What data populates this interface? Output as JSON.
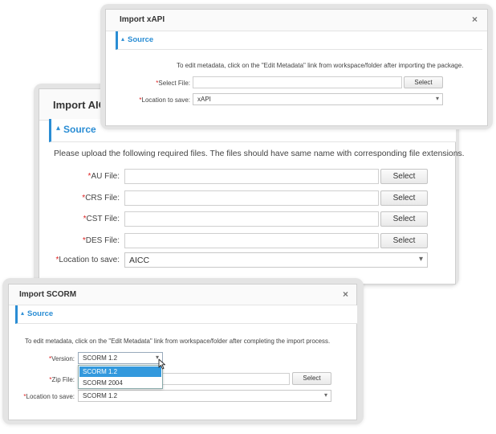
{
  "xapi": {
    "title": "Import xAPI",
    "close": "×",
    "section": "Source",
    "caret": "▴",
    "note": "To edit metadata, click on the \"Edit Metadata\" link from workspace/folder after importing the package.",
    "required": "*",
    "fields": [
      {
        "label": "Select File:",
        "button": "Select",
        "value": ""
      }
    ],
    "location_label": "Location to save:",
    "location_value": "xAPI"
  },
  "aicc": {
    "title": "Import AICC",
    "section": "Source",
    "caret": "▴",
    "note": "Please upload the following required files. The files should have same name with corresponding file extensions.",
    "required": "*",
    "fields": [
      {
        "label": "AU File:",
        "button": "Select",
        "value": ""
      },
      {
        "label": "CRS File:",
        "button": "Select",
        "value": ""
      },
      {
        "label": "CST File:",
        "button": "Select",
        "value": ""
      },
      {
        "label": "DES File:",
        "button": "Select",
        "value": ""
      }
    ],
    "location_label": "Location to save:",
    "location_value": "AICC"
  },
  "scorm": {
    "title": "Import SCORM",
    "close": "×",
    "section": "Source",
    "caret": "▴",
    "note": "To edit metadata, click on the \"Edit Metadata\" link from workspace/folder after completing the import process.",
    "required": "*",
    "version_label": "Version:",
    "version_value": "SCORM 1.2",
    "version_options": [
      "SCORM 1.2",
      "SCORM 2004"
    ],
    "zip_label": "Zip File:",
    "zip_button": "Select",
    "location_label": "Location to save:",
    "location_value": "SCORM 1.2"
  },
  "colors": {
    "accent": "#2a8dd4",
    "option_selected": "#3399dd",
    "required": "#dd2222"
  },
  "icons": {
    "dropdown": "▾",
    "cursor": "pointer-cursor-icon"
  }
}
